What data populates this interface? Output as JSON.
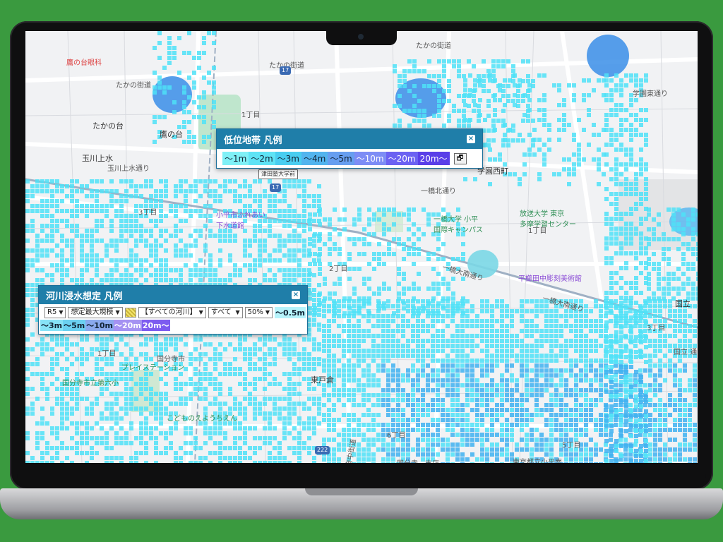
{
  "labels": {
    "poi_hospital": "鷹の台眼科",
    "takano_kaido_1": "たかの街道",
    "takano_kaido_2": "たかの街道",
    "takano_kaido_3": "たかの街道",
    "takanodai": "たかの台",
    "takanodai_station": "鷹の台",
    "tamagawa_josui": "玉川上水",
    "tamagawa_josui_dori": "玉川上水通り",
    "chome_1a": "1丁目",
    "chome_1b": "1丁目",
    "chome_1c": "1丁目",
    "chome_2": "2丁目",
    "chome_3a": "3丁目",
    "chome_3b": "3丁目",
    "chome_5": "5丁目",
    "chome_6": "6丁目",
    "gakuen_nishimachi": "学園西町",
    "hitotsubashi_kitadori": "一橋北通り",
    "hitotsubashi_univ": "一橋大学 小平\n国際キャンパス",
    "hosodai": "放送大学 東京\n多摩学習センター",
    "kodaira_fureai": "小平市ふれあい\n下水道館",
    "hitotsubashi_minami_1": "一橋大南通り",
    "hitotsubashi_minami_2": "一橋大南通り",
    "hiratsuka": "平櫛田中彫刻美術館",
    "kokubunji_daiishi": "国分寺市立第六小",
    "place_stage": "プレイステーション",
    "higashi_koigakubo": "東戸倉",
    "kokubunji_1": "国分寺市",
    "kunitachi": "国立",
    "youchien": "こどものえようちえん",
    "kokubunji_shopping": "国分寺　支店",
    "tokyo_toritsu": "東京都立小平南",
    "gakuen_east": "学園東通り",
    "kokubunji_dori": "国立 通",
    "tsudajuku": "津田塾大学前",
    "route17": "17",
    "route222": "222",
    "mikotoba": "府中街道"
  },
  "lowland_legend": {
    "title": "低位地帯 凡例",
    "close_label": "×",
    "restore_label": "🗗",
    "chips": [
      {
        "label": "〜1m",
        "color": "#7ff0f6"
      },
      {
        "label": "〜2m",
        "color": "#5fe3f5"
      },
      {
        "label": "〜3m",
        "color": "#49cdf0"
      },
      {
        "label": "〜4m",
        "color": "#52b4ee"
      },
      {
        "label": "〜5m",
        "color": "#679ef0"
      },
      {
        "label": "〜10m",
        "color": "#7d8df5"
      },
      {
        "label": "〜20m",
        "color": "#6c62f2"
      },
      {
        "label": "20m〜",
        "color": "#5a3fe8"
      }
    ]
  },
  "flood_legend": {
    "title": "河川浸水想定 凡例",
    "close_label": "×",
    "year": "R5",
    "scenario": "想定最大規模",
    "river": "【すべての河川】",
    "scope": "すべて",
    "opacity": "50%",
    "chips": [
      {
        "label": "〜0.5m",
        "color": "#b6f3fb"
      },
      {
        "label": "〜3m",
        "color": "#87e3f7"
      },
      {
        "label": "〜5m",
        "color": "#6bd1f1"
      },
      {
        "label": "〜10m",
        "color": "#8aa9ee"
      },
      {
        "label": "〜20m",
        "color": "#a592f2"
      },
      {
        "label": "20m〜",
        "color": "#7d5cf0"
      }
    ]
  },
  "colors": {
    "flood_cyan": "#4fe2f7",
    "flood_blue": "#3fb2f0",
    "lake_blue": "#3a8ee8",
    "park_green": "#a8e0c0",
    "background_green": "#3a9a3f",
    "header_blue": "#1f7ea9"
  }
}
